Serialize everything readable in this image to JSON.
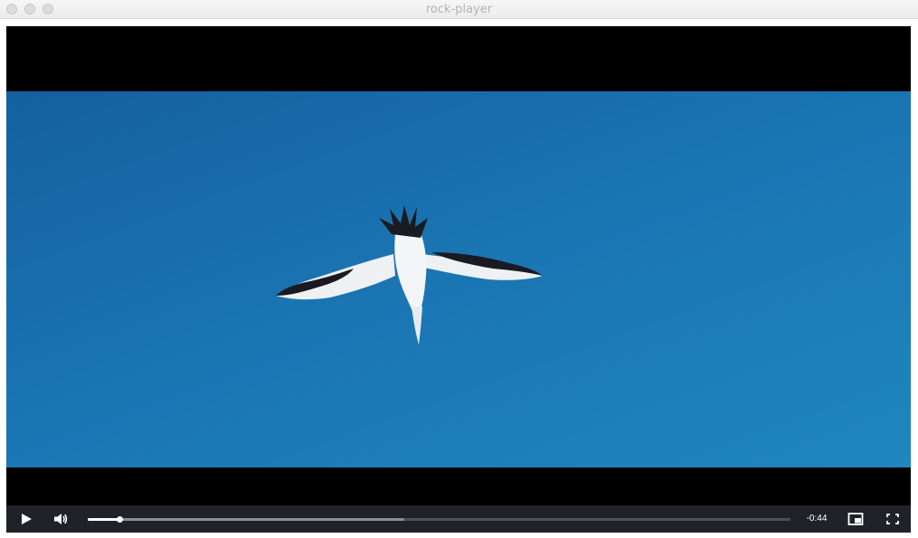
{
  "window": {
    "title": "rock-player",
    "buttons": [
      "close",
      "minimize",
      "zoom"
    ]
  },
  "video": {
    "background_color": "#1a74b2",
    "scene": "bird-icon"
  },
  "controls": {
    "play_icon": "play-icon",
    "volume_icon": "volume-icon",
    "pip_icon": "picture-in-picture-icon",
    "fullscreen_icon": "fullscreen-icon",
    "progress_played_fraction": 0.045,
    "progress_buffered_fraction": 0.45,
    "time_remaining": "-0:44"
  }
}
